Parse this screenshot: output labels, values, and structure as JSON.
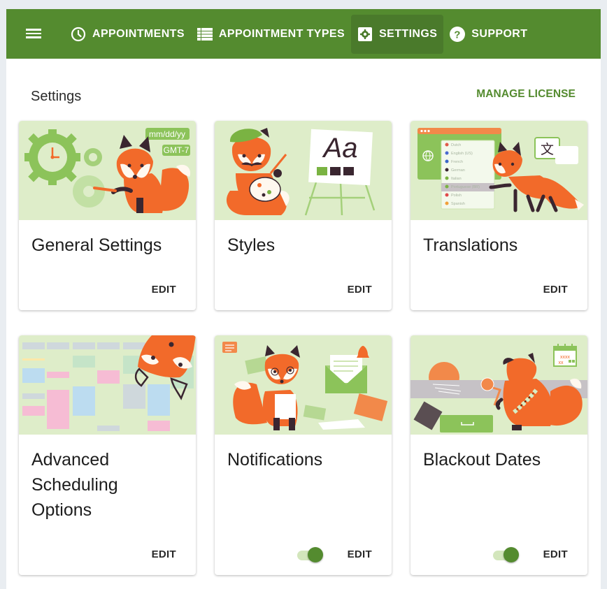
{
  "nav": {
    "items": [
      {
        "label": "APPOINTMENTS",
        "icon": "clock-icon",
        "active": false
      },
      {
        "label": "APPOINTMENT TYPES",
        "icon": "list-icon",
        "active": false
      },
      {
        "label": "SETTINGS",
        "icon": "gear-icon",
        "active": true
      },
      {
        "label": "SUPPORT",
        "icon": "help-circle-icon",
        "active": false
      }
    ]
  },
  "page": {
    "title": "Settings",
    "manage_license_label": "MANAGE LICENSE"
  },
  "colors": {
    "brand": "#548b2f",
    "card_art_bg": "#deedc9",
    "fox_orange": "#f26a2a"
  },
  "cards": [
    {
      "title": "General Settings",
      "edit_label": "EDIT",
      "has_toggle": false,
      "art": {
        "date_format": "mm/dd/yy",
        "timezone": "GMT-7"
      }
    },
    {
      "title": "Styles",
      "edit_label": "EDIT",
      "has_toggle": false,
      "art": {
        "sample_text": "Aa"
      }
    },
    {
      "title": "Translations",
      "edit_label": "EDIT",
      "has_toggle": false,
      "art": {
        "languages": [
          "Dutch",
          "English (US)",
          "French",
          "German",
          "Italian",
          "Portuguese (BR)",
          "Polish",
          "Spanish"
        ],
        "glyph": "文"
      }
    },
    {
      "title": "Advanced Scheduling Options",
      "edit_label": "EDIT",
      "has_toggle": false
    },
    {
      "title": "Notifications",
      "edit_label": "EDIT",
      "has_toggle": true,
      "toggle_on": true
    },
    {
      "title": "Blackout Dates",
      "edit_label": "EDIT",
      "has_toggle": true,
      "toggle_on": true
    }
  ]
}
